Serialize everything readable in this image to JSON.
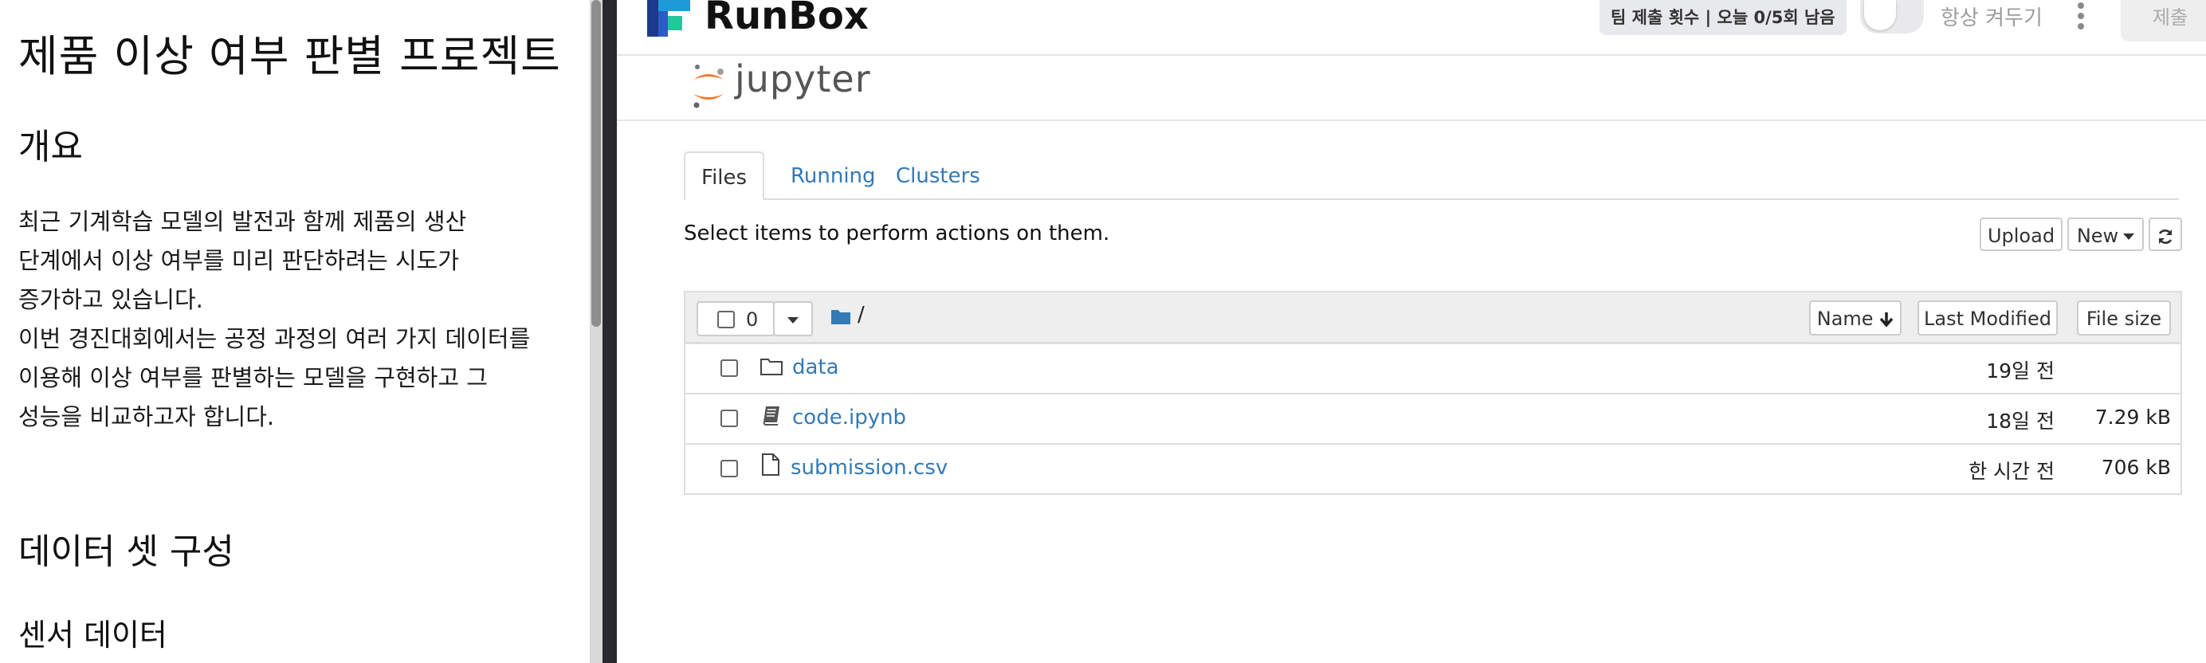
{
  "doc": {
    "title": "제품 이상 여부 판별 프로젝트",
    "overview_heading": "개요",
    "overview_lines": [
      "최근 기계학습 모델의 발전과 함께 제품의 생산",
      "단계에서 이상 여부를 미리 판단하려는 시도가",
      "증가하고 있습니다.",
      "이번 경진대회에서는 공정 과정의 여러 가지 데이터를",
      "이용해 이상 여부를 판별하는 모델을 구현하고 그",
      "성능을 비교하고자 합니다."
    ],
    "dataset_heading": "데이터 셋 구성",
    "sensor_heading": "센서 데이터"
  },
  "topbar": {
    "brand": "RunBox",
    "submission_badge": "팀 제출 횟수 | 오늘 0/5회 남음",
    "toggle_label": "항상 켜두기",
    "submit_label": "제출",
    "brand_colors": [
      "#1e9bd7",
      "#20c997",
      "#1b3a8c"
    ]
  },
  "jupyter": {
    "logo_text": "jupyter",
    "tabs": [
      {
        "label": "Files",
        "active": true
      },
      {
        "label": "Running",
        "active": false
      },
      {
        "label": "Clusters",
        "active": false
      }
    ],
    "instructions": "Select items to perform actions on them.",
    "upload_label": "Upload",
    "new_label": "New",
    "refresh_icon": "refresh-icon",
    "selected_count": "0",
    "breadcrumb": "/",
    "columns": {
      "name": "Name",
      "modified": "Last Modified",
      "size": "File size"
    },
    "files": [
      {
        "name": "data",
        "type": "folder",
        "modified": "19일 전",
        "size": ""
      },
      {
        "name": "code.ipynb",
        "type": "notebook",
        "modified": "18일 전",
        "size": "7.29 kB"
      },
      {
        "name": "submission.csv",
        "type": "file",
        "modified": "한 시간 전",
        "size": "706 kB"
      }
    ],
    "link_color": "#337ab7"
  }
}
